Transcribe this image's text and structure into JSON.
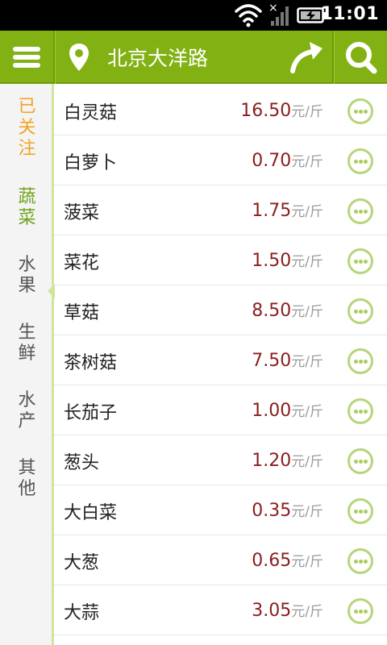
{
  "status_bar": {
    "time": "11:01"
  },
  "topbar": {
    "location": "北京大洋路"
  },
  "categories": [
    {
      "label": "已关注",
      "state": "followed"
    },
    {
      "label": "蔬菜",
      "state": "active"
    },
    {
      "label": "水果",
      "state": "normal"
    },
    {
      "label": "生鲜",
      "state": "normal"
    },
    {
      "label": "水产",
      "state": "normal"
    },
    {
      "label": "其他",
      "state": "normal"
    }
  ],
  "unit": "元/斤",
  "items": [
    {
      "name": "白灵菇",
      "price": "16.50"
    },
    {
      "name": "白萝卜",
      "price": "0.70"
    },
    {
      "name": "菠菜",
      "price": "1.75"
    },
    {
      "name": "菜花",
      "price": "1.50"
    },
    {
      "name": "草菇",
      "price": "8.50"
    },
    {
      "name": "茶树菇",
      "price": "7.50"
    },
    {
      "name": "长茄子",
      "price": "1.00"
    },
    {
      "name": "葱头",
      "price": "1.20"
    },
    {
      "name": "大白菜",
      "price": "0.35"
    },
    {
      "name": "大葱",
      "price": "0.65"
    },
    {
      "name": "大蒜",
      "price": "3.05"
    }
  ],
  "colors": {
    "accent": "#82b113",
    "price": "#8b1d1d",
    "followed": "#f0a424",
    "active_category": "#6fa319"
  }
}
